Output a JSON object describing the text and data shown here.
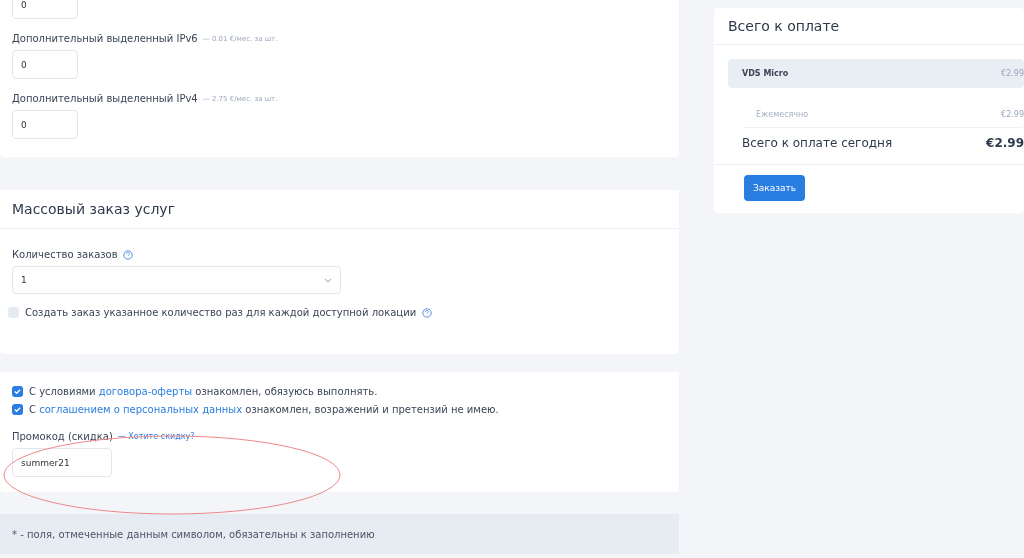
{
  "addons": {
    "fields": [
      {
        "value": "0"
      },
      {
        "label": "Дополнительный выделенный IPv6",
        "price": "— 0.01 €/мес. за шт.",
        "value": "0"
      },
      {
        "label": "Дополнительный выделенный IPv4",
        "price": "— 2.75 €/мес. за шт.",
        "value": "0"
      }
    ]
  },
  "bulk": {
    "title": "Массовый заказ услуг",
    "count_label": "Количество заказов",
    "count_value": "1",
    "per_location": {
      "label": "Создать заказ указанное количество раз для каждой доступной локации",
      "checked": false
    }
  },
  "agreements": [
    {
      "before": "С условиями",
      "link": "договора-оферты",
      "after": "ознакомлен, обязуюсь выполнять.",
      "checked": true
    },
    {
      "before": "С",
      "link": "соглашением о персональных данных",
      "after": "ознакомлен, возражений и претензий не имею.",
      "checked": true
    }
  ],
  "promo": {
    "label": "Промокод (скидка)",
    "link": "— Хотите скидку?",
    "value": "summer21"
  },
  "note": "* - поля, отмеченные данным символом, обязательны к заполнению",
  "summary": {
    "title": "Всего к оплате",
    "item": {
      "name": "VDS Micro",
      "price": "€2.99"
    },
    "period": {
      "name": "Ежемесячно",
      "price": "€2.99"
    },
    "total": {
      "name": "Всего к оплате сегодня",
      "price": "€2.99"
    },
    "button": "Заказать"
  }
}
